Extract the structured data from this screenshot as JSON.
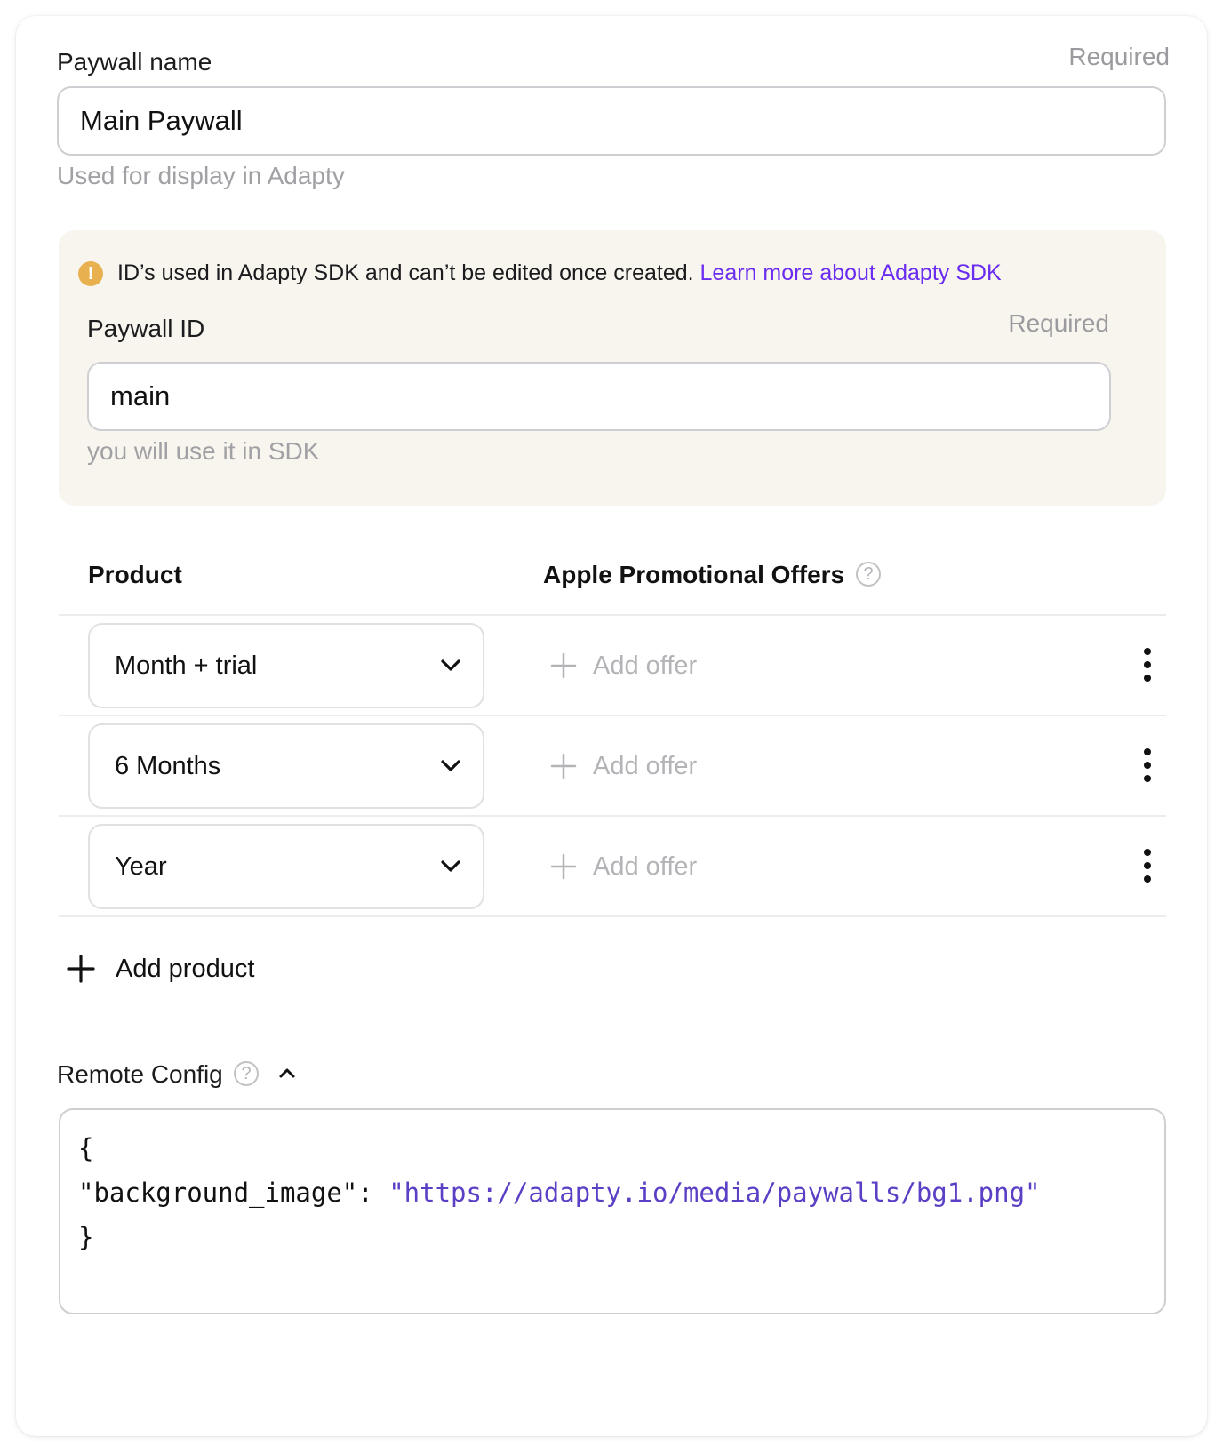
{
  "paywall_name": {
    "label": "Paywall name",
    "required": "Required",
    "value": "Main Paywall",
    "hint": "Used for display in Adapty"
  },
  "notice": {
    "text": "ID’s used in Adapty SDK and can’t be edited once created.",
    "link": "Learn more about Adapty SDK",
    "icon": "warning-icon",
    "color": "#e9b04f"
  },
  "paywall_id": {
    "label": "Paywall ID",
    "required": "Required",
    "value": "main",
    "hint": "you will use it in SDK"
  },
  "products_table": {
    "col_product": "Product",
    "col_offers": "Apple Promotional Offers",
    "rows": [
      {
        "product": "Month + trial",
        "offer": "Add offer"
      },
      {
        "product": "6 Months",
        "offer": "Add offer"
      },
      {
        "product": "Year",
        "offer": "Add offer"
      }
    ],
    "add_product": "Add product"
  },
  "remote_config": {
    "label": "Remote Config",
    "line1": "{",
    "line2_key": "\"background_image\": ",
    "line2_value": "\"https://adapty.io/media/paywalls/bg1.png\"",
    "line3": "}"
  },
  "colors": {
    "link": "#6a2cf0",
    "notice_bg": "#f8f5ee",
    "code_string": "#5b3fc4"
  }
}
